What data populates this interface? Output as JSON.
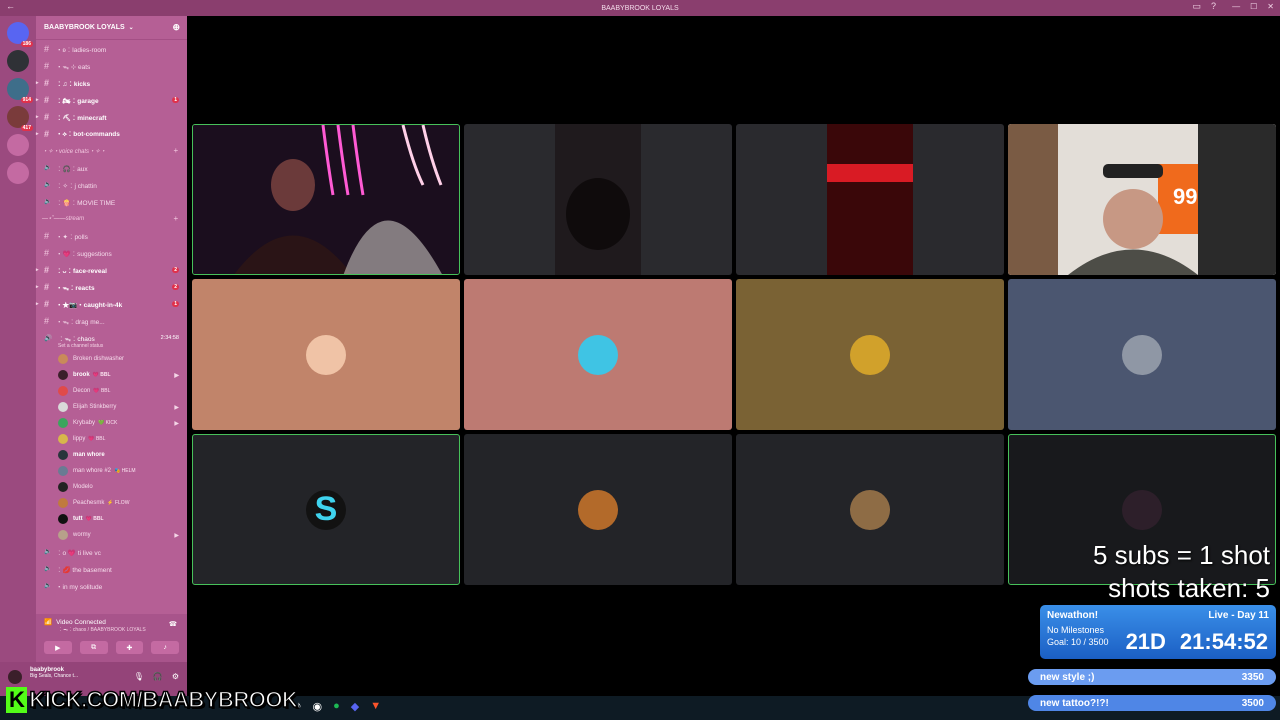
{
  "app": {
    "window_title": "BAABYBROOK LOYALS",
    "server_name": "BAABYBROOK LOYALS"
  },
  "servers": [
    {
      "icon": "discord-home-icon",
      "badge": "186"
    },
    {
      "icon": "server-icon",
      "badge": ""
    },
    {
      "icon": "server-icon",
      "badge": "914"
    },
    {
      "icon": "server-icon",
      "badge": "417"
    },
    {
      "icon": "add-server-icon",
      "badge": ""
    },
    {
      "icon": "discover-icon",
      "badge": ""
    }
  ],
  "channels_top": [
    {
      "label": "・ʚ︰ladies-room",
      "count": "",
      "arrow": false,
      "bright": false
    },
    {
      "label": "・ᯓ ⊹ eats",
      "count": "",
      "arrow": false,
      "bright": false
    },
    {
      "label": "︰♫︰kicks",
      "count": "",
      "arrow": true,
      "bright": true
    },
    {
      "label": "︰🏍︰garage",
      "count": "1",
      "arrow": true,
      "bright": true
    },
    {
      "label": "︰⛏︰minecraft",
      "count": "",
      "arrow": true,
      "bright": true
    },
    {
      "label": "・⟡︰bot-commands",
      "count": "",
      "arrow": true,
      "bright": true
    }
  ],
  "voice_category": "・✧・voice chats・✧・",
  "voice_channels_a": [
    {
      "label": "︰🎧︰aux"
    },
    {
      "label": "︰✧︰j chattin"
    },
    {
      "label": "︰🍿︰MOVIE TIME"
    }
  ],
  "stream_category": "—⋆˚——stream",
  "channels_stream": [
    {
      "label": "・✦︰polls",
      "count": "",
      "arrow": false,
      "bright": false
    },
    {
      "label": "・💗︰suggestions",
      "count": "",
      "arrow": false,
      "bright": false
    },
    {
      "label": "︰ᴗ︰face-reveal",
      "count": "2",
      "arrow": true,
      "bright": true
    },
    {
      "label": "・ᯓ︰reacts",
      "count": "2",
      "arrow": true,
      "bright": true
    },
    {
      "label": "・★📷・caught-in-4k",
      "count": "1",
      "arrow": true,
      "bright": true
    },
    {
      "label": "・ᯓ︰drag me...",
      "count": "",
      "arrow": false,
      "bright": false
    }
  ],
  "active_voice": {
    "label": "︰ᯓ︰chaos",
    "timer": "2:34:58",
    "status": "Set a channel status"
  },
  "voice_users": [
    {
      "name": "Broken dishwasher",
      "tag": "",
      "color": "#c98a5a",
      "cam": false,
      "bright": false
    },
    {
      "name": "brook",
      "tag": "💗 BBL",
      "color": "#3b1f2a",
      "cam": true,
      "bright": true
    },
    {
      "name": "Decon",
      "tag": "💗 BBL",
      "color": "#e04a4a",
      "cam": false,
      "bright": false
    },
    {
      "name": "Elijah Stinkberry",
      "tag": "",
      "color": "#d9d9d9",
      "cam": true,
      "bright": false
    },
    {
      "name": "Krybaby",
      "tag": "💚 KICK",
      "color": "#3ba55d",
      "cam": true,
      "bright": false
    },
    {
      "name": "lippy",
      "tag": "💗 BBL",
      "color": "#d7b64b",
      "cam": false,
      "bright": false
    },
    {
      "name": "man whore",
      "tag": "",
      "color": "#27353b",
      "cam": false,
      "bright": true
    },
    {
      "name": "man whore #2",
      "tag": "🎭 HELM",
      "color": "#6a7b93",
      "cam": false,
      "bright": false
    },
    {
      "name": "Modelo",
      "tag": "",
      "color": "#222222",
      "cam": false,
      "bright": false
    },
    {
      "name": "Peachesmk",
      "tag": "⚡ FLOW",
      "color": "#c07a3e",
      "cam": false,
      "bright": false
    },
    {
      "name": "tutt",
      "tag": "💗 BBL",
      "color": "#111111",
      "cam": false,
      "bright": true
    },
    {
      "name": "wormy",
      "tag": "",
      "color": "#b7a18a",
      "cam": true,
      "bright": false
    }
  ],
  "voice_channels_b": [
    {
      "label": "︰o 💗 ti live vc"
    },
    {
      "label": "︰💋 the basement"
    },
    {
      "label": "・in my solitude"
    }
  ],
  "vc_panel": {
    "status": "Video Connected",
    "location": "︰ᯓ︰chaos / BAABYBROOK LOYALS"
  },
  "user_panel": {
    "name": "baabybrook",
    "status": "Big Seals, Chance t..."
  },
  "tiles": [
    {
      "kind": "video",
      "bg": "#1a0d1d",
      "border": "#47c15a"
    },
    {
      "kind": "video",
      "bg": "#2a2a2e",
      "border": ""
    },
    {
      "kind": "video",
      "bg": "#2a2a2e",
      "border": ""
    },
    {
      "kind": "video",
      "bg": "#d9d2cc",
      "border": ""
    },
    {
      "kind": "avatar",
      "bg": "#c1846a",
      "avatar": "#f0c3a6",
      "border": ""
    },
    {
      "kind": "avatar",
      "bg": "#bd7a72",
      "avatar": "#3fc4e4",
      "border": ""
    },
    {
      "kind": "avatar",
      "bg": "#7a6234",
      "avatar": "#d1a12b",
      "border": ""
    },
    {
      "kind": "avatar",
      "bg": "#4b5670",
      "avatar": "#8f97a5",
      "border": ""
    },
    {
      "kind": "avatar",
      "bg": "#232428",
      "avatar": "#121212",
      "border": "#47c15a",
      "letter": "S"
    },
    {
      "kind": "avatar",
      "bg": "#232428",
      "avatar": "#b36a2a",
      "border": ""
    },
    {
      "kind": "avatar",
      "bg": "#232428",
      "avatar": "#8e6c45",
      "border": ""
    },
    {
      "kind": "avatar",
      "bg": "#18191c",
      "avatar": "#2d1f2a",
      "border": "#47c15a"
    }
  ],
  "overlay": {
    "subs_line": "5 subs = 1 shot",
    "shots_line": "shots taken: 5",
    "subathon_title": "Newathon!",
    "subathon_status": "Live - Day 11",
    "milestones": "No Milestones",
    "goal": "Goal: 10 / 3500",
    "countdown_days": "21D",
    "countdown_time": "21:54:52",
    "bar1_label": "new style ;)",
    "bar1_value": "3350",
    "bar2_label": "new tattoo?!?!",
    "bar2_value": "3500"
  },
  "kick_banner": {
    "k": "K",
    "text": "KICK.COM/BAABYBROOK"
  },
  "colors": {
    "titlebar": "#8a3e6e",
    "sidebar": "#b55f95",
    "server_rail": "#9b4a7f",
    "speaking_border": "#47c15a",
    "kick_green": "#53fc18"
  }
}
